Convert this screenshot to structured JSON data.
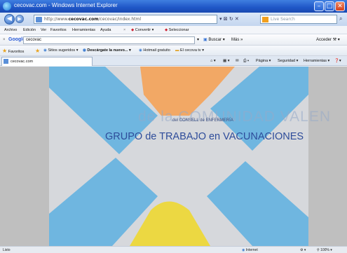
{
  "window": {
    "title": "cecovac.com - Windows Internet Explorer",
    "min_label": "–",
    "max_label": "□",
    "close_label": "✕"
  },
  "addressbar": {
    "url_prefix": "http://www.",
    "url_domain": "cecovac.com",
    "url_suffix": "/cecovac/index.html",
    "go_icons": "▾ ⊠ ↻ ✕",
    "search_placeholder": "Live Search"
  },
  "menu": {
    "items": [
      "Archivo",
      "Edición",
      "Ver",
      "Favoritos",
      "Herramientas",
      "Ayuda"
    ],
    "convert_label": "Convertir",
    "select_label": "Seleccionar"
  },
  "google_toolbar": {
    "logo": "Google",
    "query": "cecovac",
    "search_label": "Buscar",
    "more_label": "Más »",
    "signin_label": "Acceder"
  },
  "favorites_bar": {
    "favorites_label": "Favoritos",
    "items": [
      "Sitios sugeridos",
      "Descárgate la nuevo...",
      "Hotmail gratuito",
      "El cecova tv"
    ]
  },
  "tabs": {
    "active_tab": "cecovac.com"
  },
  "command_bar": {
    "page_label": "Página",
    "safety_label": "Seguridad",
    "tools_label": "Herramientas"
  },
  "content": {
    "comunidad_text": "de la COMUNIDAD VALEN",
    "del_consell_text": "del CONSELL de ENFERMERÍA",
    "grupo_text": "GRUPO de TRABAJO en VACUNACIONES",
    "colors": {
      "blue": "#6fb6e0",
      "orange": "#f2a865",
      "yellow": "#ecd842",
      "center": "#d6d8dc"
    }
  },
  "statusbar": {
    "status_text": "Listo",
    "zone_label": "Internet",
    "zoom_label": "100%"
  }
}
